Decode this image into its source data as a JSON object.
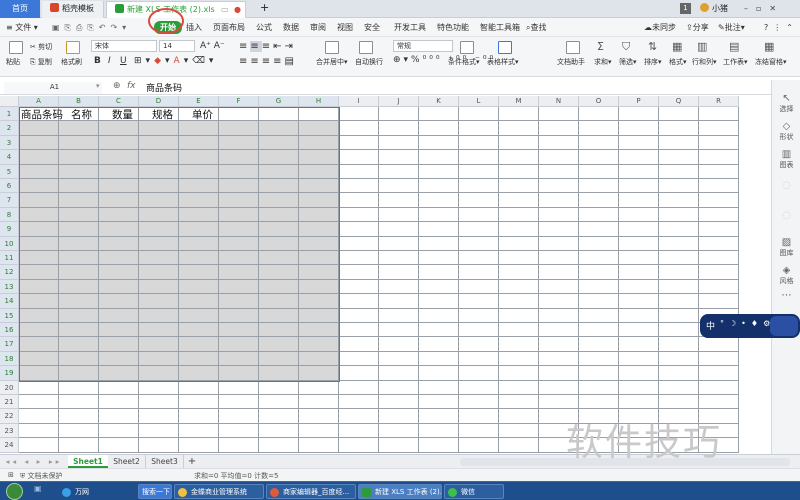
{
  "tabs": {
    "home": "首页",
    "template": "稻壳模板",
    "file": "新建 XLS 工作表 (2).xls",
    "add": "+"
  },
  "window": {
    "user": "小猪",
    "badge": "1"
  },
  "menus": [
    "开始",
    "插入",
    "页面布局",
    "公式",
    "数据",
    "审阅",
    "视图",
    "安全",
    "开发工具",
    "特色功能",
    "智能工具箱"
  ],
  "menu_file": "文件",
  "menu_find": "查找",
  "menu_right": {
    "sync": "未同步",
    "share": "分享",
    "comment": "批注"
  },
  "ribbon": {
    "paste": "粘贴",
    "cut": "剪切",
    "copy": "复制",
    "format_painter": "格式刷",
    "font": "宋体",
    "size": "14",
    "bold": "B",
    "italic": "I",
    "underline": "U",
    "merge": "合并居中",
    "wrap": "自动换行",
    "number_format": "常规",
    "cond_format": "条件格式",
    "table_style": "表格样式",
    "doc_helper": "文档助手",
    "sum": "求和",
    "filter": "筛选",
    "sort": "排序",
    "format": "格式",
    "rowcol": "行和列",
    "sheet": "工作表",
    "freeze": "冻结窗格"
  },
  "formula_bar": {
    "cell_ref": "A1",
    "fx": "fx",
    "content": "商品条码"
  },
  "columns": [
    "A",
    "B",
    "C",
    "D",
    "E",
    "F",
    "G",
    "H",
    "I",
    "J",
    "K",
    "L",
    "M",
    "N",
    "O",
    "P",
    "Q",
    "R"
  ],
  "rows": [
    "1",
    "2",
    "3",
    "4",
    "5",
    "6",
    "7",
    "8",
    "9",
    "10",
    "11",
    "12",
    "13",
    "14",
    "15",
    "16",
    "17",
    "18",
    "19",
    "20",
    "21",
    "22",
    "23",
    "24"
  ],
  "headers": [
    "商品条码",
    "名称",
    "数量",
    "规格",
    "单价"
  ],
  "right_panel": [
    "选择",
    "形状",
    "图表",
    "",
    "",
    "图库",
    "风格"
  ],
  "sheets": [
    "Sheet1",
    "Sheet2",
    "Sheet3",
    "+"
  ],
  "status": {
    "protect": "文档未保护",
    "stats": "求和=0  平均值=0  计数=5"
  },
  "taskbar": [
    {
      "label": "万网"
    },
    {
      "label": "搜索一下"
    },
    {
      "label": "金蝶商业管理系统"
    },
    {
      "label": "商家编辑器_百度经..."
    },
    {
      "label": "新建 XLS 工作表 (2)..."
    },
    {
      "label": "微信"
    }
  ],
  "ime": {
    "text": "中"
  },
  "watermark": "软件技巧",
  "colors": {
    "accent": "#2c9c3a",
    "selection": "#3a9a3a",
    "shade": "#d8d8d8",
    "tab_blue": "#3b78d8"
  }
}
